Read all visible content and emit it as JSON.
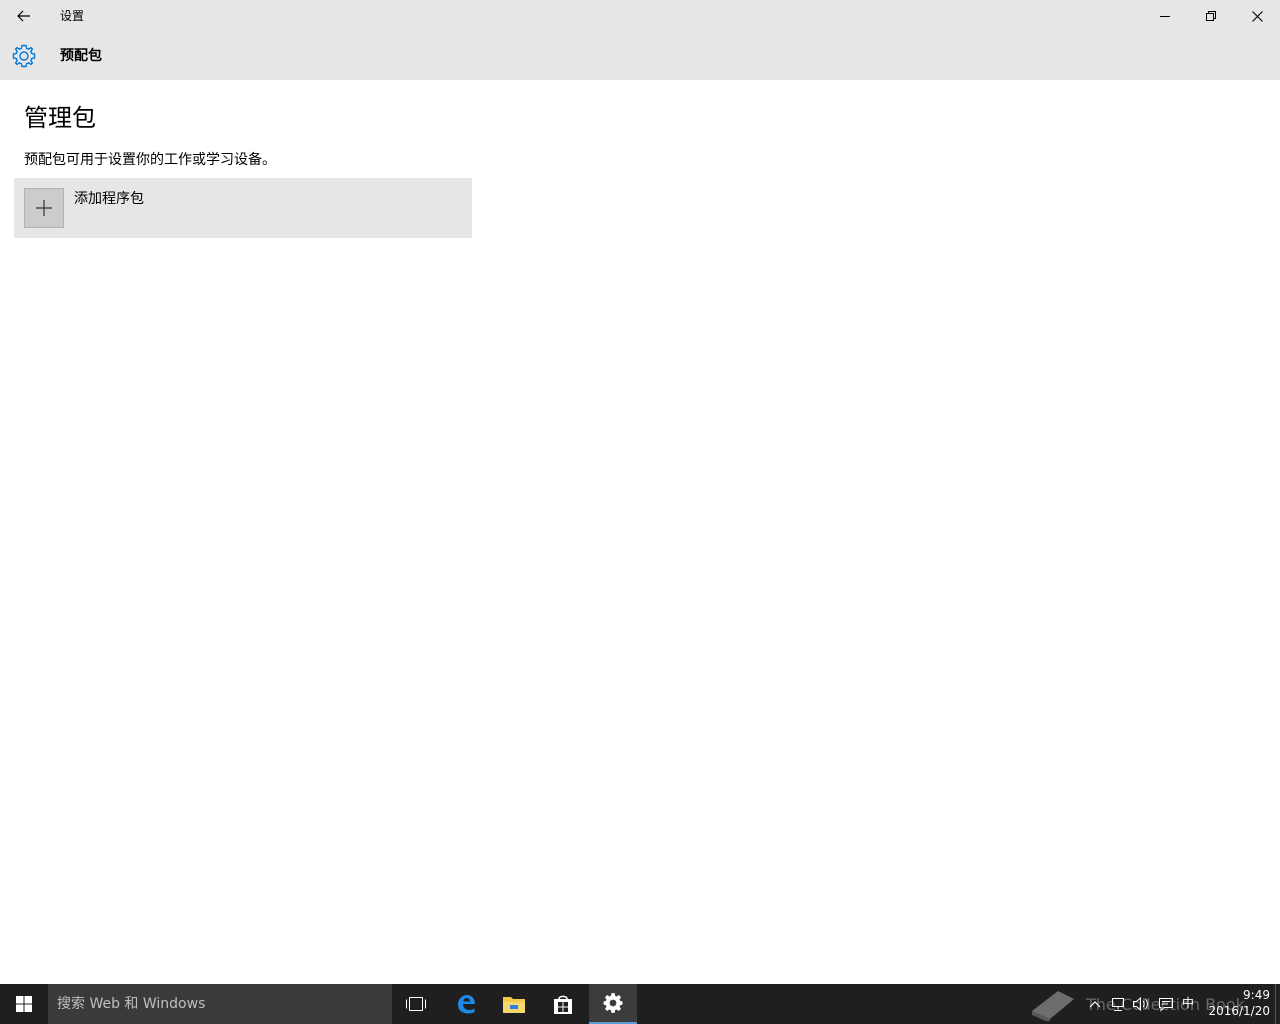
{
  "window": {
    "app_title": "设置",
    "page_header": "预配包"
  },
  "content": {
    "section_title": "管理包",
    "description": "预配包可用于设置你的工作或学习设备。",
    "add_package_label": "添加程序包"
  },
  "taskbar": {
    "search_placeholder": "搜索 Web 和 Windows",
    "apps": [
      {
        "name": "task-view-icon"
      },
      {
        "name": "edge-icon"
      },
      {
        "name": "file-explorer-icon"
      },
      {
        "name": "store-icon"
      },
      {
        "name": "settings-icon",
        "active": true
      }
    ],
    "tray": {
      "ime": "中",
      "time": "9:49",
      "date": "2016/1/20"
    },
    "watermark": "The Collection Book"
  },
  "colors": {
    "titlebar_bg": "#e6e6e6",
    "accent": "#0078d7",
    "taskbar_bg": "#1f1f1f",
    "search_bg": "#3a3a3a"
  }
}
